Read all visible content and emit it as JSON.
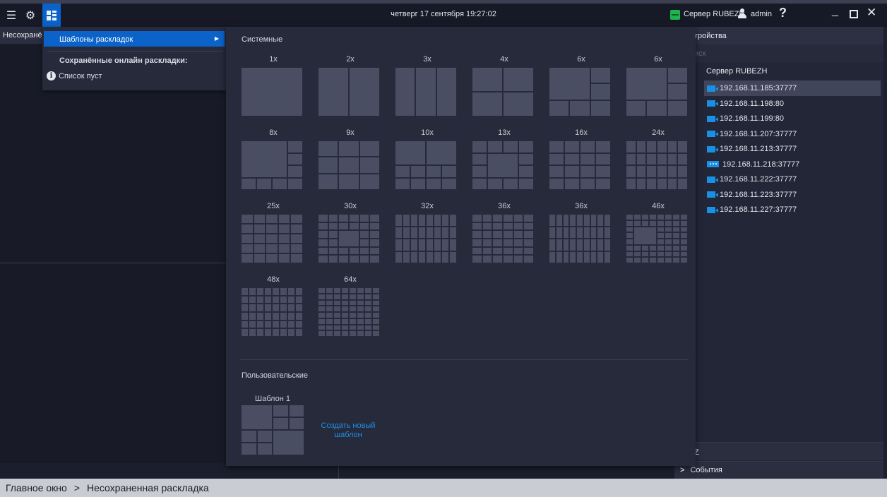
{
  "topbar": {
    "datetime": "четверг 17 сентября 19:27:02",
    "server_name": "Сервер RUBEZH",
    "user_name": "admin",
    "help": "?",
    "minimize": "_",
    "close": "✕"
  },
  "workspace": {
    "tab_label": "Несохранённая"
  },
  "menu": {
    "templates_label": "Шаблоны раскладок",
    "saved_title": "Сохранённые онлайн раскладки:",
    "empty_text": "Список пуст"
  },
  "templates": {
    "system_title": "Системные",
    "user_title": "Пользовательские",
    "system": [
      "1x",
      "2x",
      "3x",
      "4x",
      "6x",
      "6x",
      "8x",
      "9x",
      "10x",
      "13x",
      "16x",
      "24x",
      "25x",
      "30x",
      "32x",
      "36x",
      "36x",
      "46x",
      "48x",
      "64x"
    ],
    "user": [
      {
        "name": "Шаблон 1"
      }
    ],
    "create_link": "Создать новый шаблон"
  },
  "right_panel": {
    "header": "тройства",
    "search_placeholder": "иск",
    "server": "Сервер RUBEZH",
    "devices": [
      {
        "address": "192.168.11.185:37777",
        "selected": true,
        "icon": "camera-icon"
      },
      {
        "address": "192.168.11.198:80",
        "selected": false,
        "icon": "camera-icon"
      },
      {
        "address": "192.168.11.199:80",
        "selected": false,
        "icon": "camera-icon"
      },
      {
        "address": "192.168.11.207:37777",
        "selected": false,
        "icon": "camera-icon"
      },
      {
        "address": "192.168.11.213:37777",
        "selected": false,
        "icon": "camera-icon"
      },
      {
        "address": "192.168.11.218:37777",
        "selected": false,
        "icon": "multi-device-icon"
      },
      {
        "address": "192.168.11.222:37777",
        "selected": false,
        "icon": "camera-icon"
      },
      {
        "address": "192.168.11.223:37777",
        "selected": false,
        "icon": "camera-icon"
      },
      {
        "address": "192.168.11.227:37777",
        "selected": false,
        "icon": "camera-icon"
      }
    ],
    "ptz_label": "Z",
    "events_label": "События"
  },
  "statusbar": {
    "crumb_root": "Главное окно",
    "separator": ">",
    "crumb_current": "Несохраненная раскладка"
  },
  "colors": {
    "accent": "#0b62c9",
    "background": "#1b1e2c",
    "menu": "#262a3a",
    "tile": "#4a4e63",
    "camera": "#1a8fe3",
    "server_ok": "#1db64e",
    "link": "#1e8fe6"
  }
}
